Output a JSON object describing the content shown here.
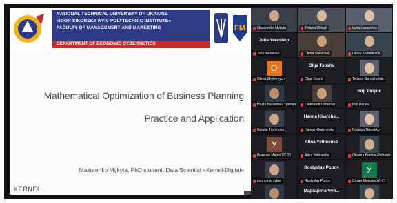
{
  "slide": {
    "header_lines": [
      "NATIONAL TECHNICAL UNIVERSITY OF UKRAINE",
      "«IGOR SIKORSKY KYIV POLYTECHNIC INSTITUTE»",
      "FACULTY OF MANAGEMENT AND MARKETING"
    ],
    "department": "DEPARTMENT OF ECONOMIC CYBERNETICS",
    "title_line1": "Mathematical Optimization of Business Planning",
    "title_line2": "Practice and Application",
    "author": "Mazurenko Mykyta, PhD student, Data Scientist «Kernel-Digital»",
    "logo": "KERNEL"
  },
  "participants": [
    {
      "big": "",
      "caption": "Mazurenko Mykyta",
      "type": "video",
      "speaking": true
    },
    {
      "big": "",
      "caption": "Tetiana Oliinyk",
      "type": "video"
    },
    {
      "big": "",
      "caption": "Iryna Lazarenko",
      "type": "video"
    },
    {
      "big": "Julia Yereshko",
      "caption": "Julia Yereshko",
      "type": "name"
    },
    {
      "big": "",
      "caption": "Olena Shevchuk",
      "type": "video"
    },
    {
      "big": "",
      "caption": "Olena Zolotukhina",
      "type": "video"
    },
    {
      "big": "",
      "avatar": "O",
      "caption": "Olena Zhylkevych",
      "type": "avatar",
      "avatar_color": "#e7761f"
    },
    {
      "big": "Olga Tsoshv",
      "caption": "Olga Tsoshv",
      "type": "name"
    },
    {
      "big": "",
      "caption": "Tetiana Ganushchak",
      "type": "video"
    },
    {
      "big": "",
      "caption": "Надія Василівна Григоренко",
      "type": "video"
    },
    {
      "big": "",
      "caption": "Oleksandr Ushenko",
      "type": "video"
    },
    {
      "big": "Ігор Рицюк",
      "caption": "Ігор Рицюк",
      "type": "name"
    },
    {
      "big": "",
      "caption": "Natalia Trofimova",
      "type": "video"
    },
    {
      "big": "Hanna  Kharche...",
      "caption": "Hanna Kharchenko",
      "type": "name"
    },
    {
      "big": "",
      "caption": "Nataliya Tereshko",
      "type": "video"
    },
    {
      "big": "",
      "avatar": "У",
      "caption": "Роченко Марія УС-21",
      "type": "avatar",
      "avatar_color": "#7a4b3a"
    },
    {
      "big": "Alina Yefimenko",
      "caption": "Alina Yefimenko",
      "type": "name"
    },
    {
      "big": "",
      "caption": "Oksana Bondar-Pidhurska",
      "type": "video"
    },
    {
      "big": "",
      "caption": "economic cyber",
      "type": "video"
    },
    {
      "big": "Rostyslav Popov",
      "caption": "Rostyslav Popov",
      "type": "name"
    },
    {
      "big": "",
      "avatar": "У",
      "caption": "Сохан Максим УА-21",
      "type": "avatar",
      "avatar_color": "#137a4a"
    },
    {
      "big": "",
      "caption": "УА-21 Растов Валерія",
      "type": "video"
    },
    {
      "big": "Маргарита  Чуп...",
      "caption": "Маргарита Чуприна",
      "type": "name"
    },
    {
      "big": "",
      "caption": "Сергій Костенко",
      "type": "video"
    }
  ],
  "colors": {
    "header_band": "#2d3b86",
    "department_strip": "#c62a2a",
    "active_speaker": "#7fd33b",
    "muted_icon": "#e23a3a"
  }
}
